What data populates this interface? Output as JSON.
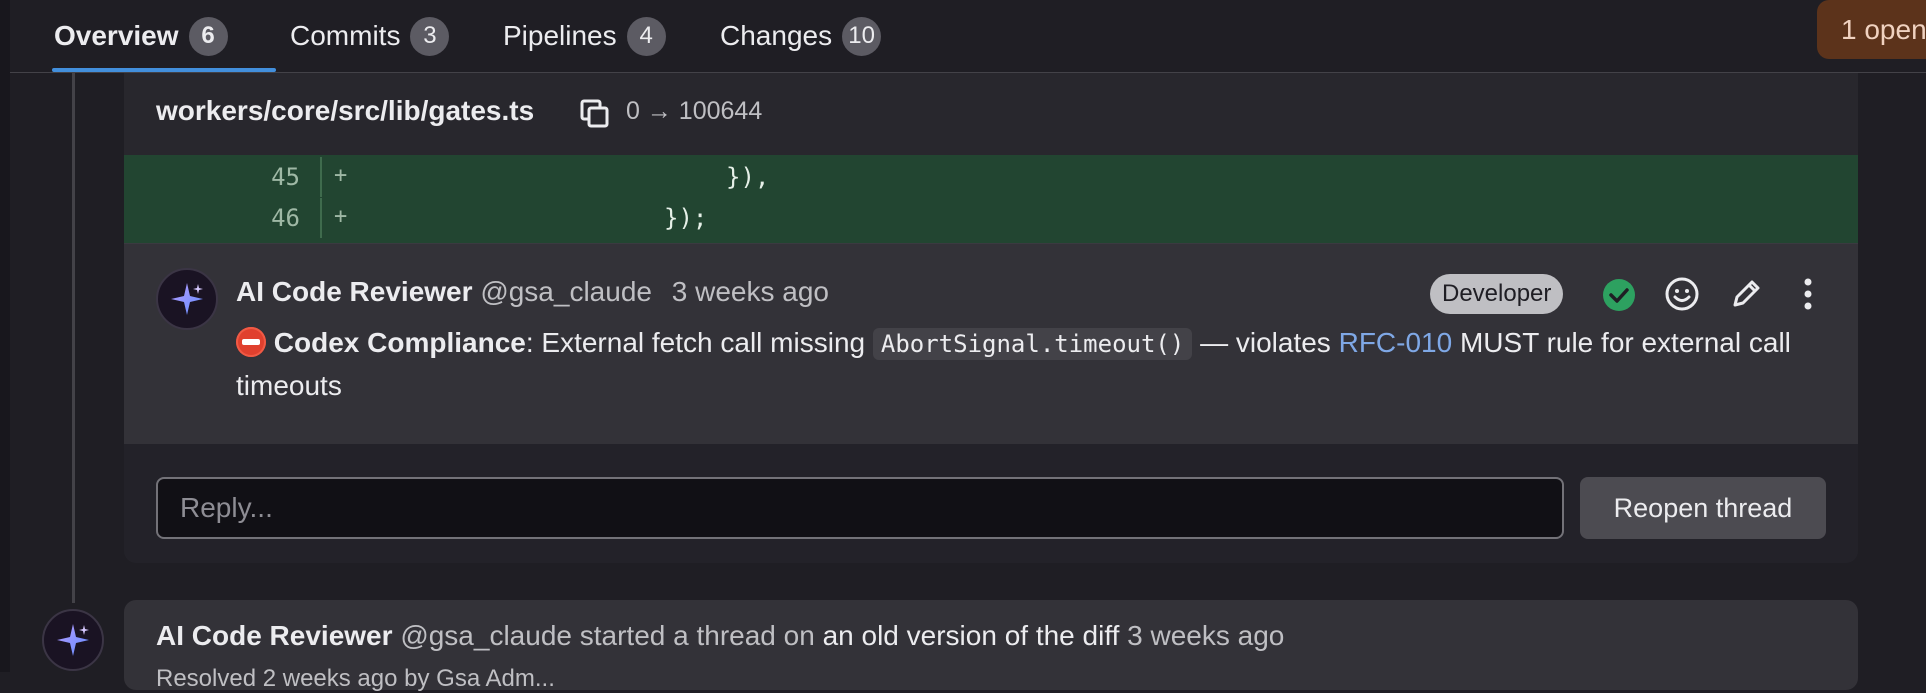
{
  "tabs": [
    {
      "label": "Overview",
      "count": "6"
    },
    {
      "label": "Commits",
      "count": "3"
    },
    {
      "label": "Pipelines",
      "count": "4"
    },
    {
      "label": "Changes",
      "count": "10"
    }
  ],
  "open_badge": "1 open",
  "file": {
    "path": "workers/core/src/lib/gates.ts",
    "mode": "0 → 100644"
  },
  "diff_lines": [
    {
      "line": "45",
      "sign": "+",
      "code": "});"
    },
    {
      "line": "46",
      "sign": "+",
      "code": "});"
    }
  ],
  "diff_code_row1": "}),",
  "note": {
    "author": "AI Code Reviewer",
    "handle": "@gsa_claude",
    "time": "3 weeks ago",
    "role": "Developer",
    "title": "Codex Compliance",
    "text_before_code": ": External fetch call missing ",
    "code": "AbortSignal.timeout()",
    "text_after_code": " — violates ",
    "link": "RFC-010",
    "text_end": " MUST rule for external call timeouts"
  },
  "reply": {
    "placeholder": "Reply...",
    "reopen_label": "Reopen thread"
  },
  "thread2": {
    "author": "AI Code Reviewer",
    "handle": "@gsa_claude",
    "started": "started a thread on",
    "link": "an old version of the diff",
    "time": "3 weeks ago",
    "cut_text": "Resolved 2 weeks ago by Gsa Adm..."
  },
  "colors": {
    "accent": "#428fdc",
    "diff_added_bg": "#224531",
    "link": "#7fa8e6",
    "resolved": "#2da160",
    "alert": "#e0402e"
  },
  "icons": [
    "copy-icon",
    "stop-sign-icon",
    "resolved-check-icon",
    "emoji-icon",
    "pencil-icon",
    "kebab-menu-icon",
    "sparkle-avatar-icon"
  ]
}
